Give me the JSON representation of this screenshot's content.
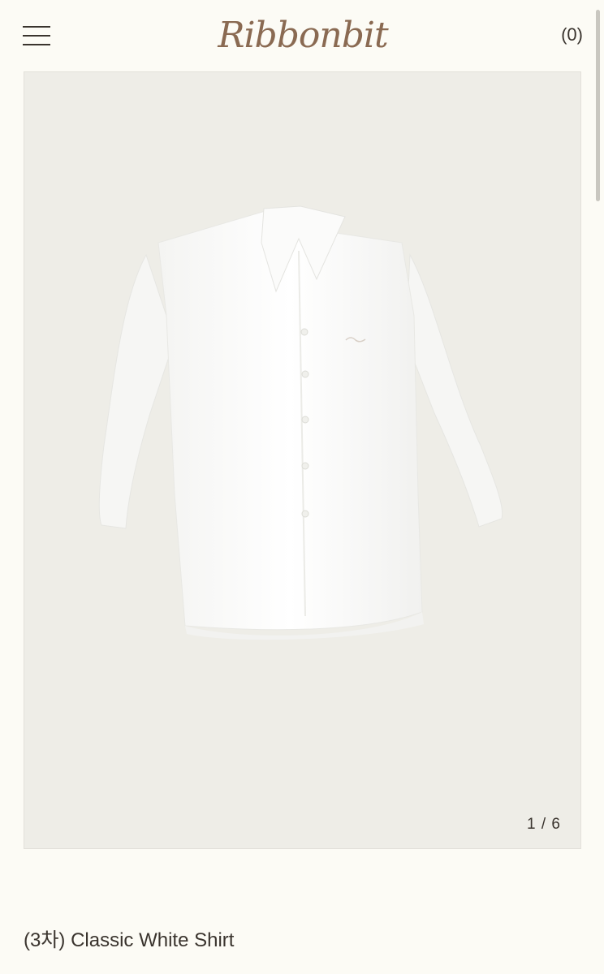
{
  "header": {
    "logo_text": "Ribbonbit",
    "cart_label": "(0)"
  },
  "gallery": {
    "counter": "1 / 6",
    "image_alt": "white-shirt-product-photo"
  },
  "product": {
    "title": "(3차) Classic White Shirt"
  },
  "colors": {
    "page_bg": "#fcfbf5",
    "gallery_bg": "#eeede7",
    "logo_brown": "#8a6a52",
    "text": "#3a342e"
  }
}
